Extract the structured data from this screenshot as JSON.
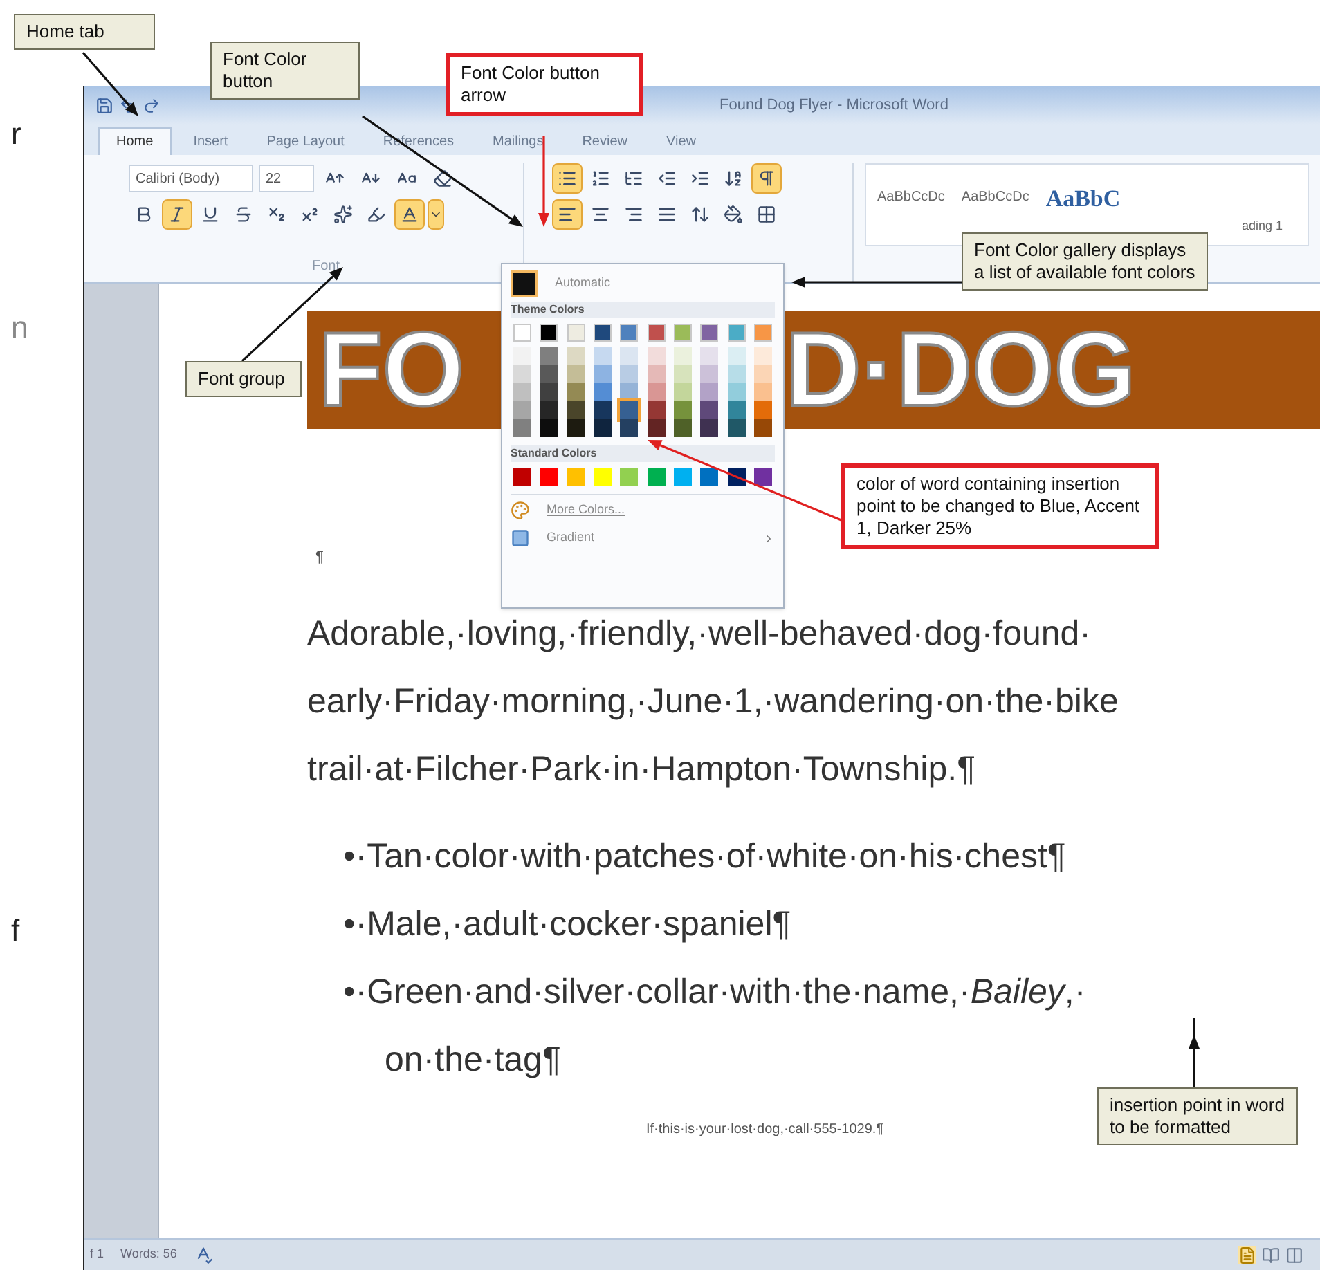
{
  "margin_text": [
    "r",
    "n",
    "f"
  ],
  "window": {
    "title": "Found Dog Flyer - Microsoft Word"
  },
  "tabs": [
    {
      "label": "Home",
      "selected": true
    },
    {
      "label": "Insert",
      "selected": false
    },
    {
      "label": "Page Layout",
      "selected": false
    },
    {
      "label": "References",
      "selected": false
    },
    {
      "label": "Mailings",
      "selected": false
    },
    {
      "label": "Review",
      "selected": false
    },
    {
      "label": "View",
      "selected": false
    }
  ],
  "ribbon": {
    "font": {
      "name": "Calibri (Body)",
      "size": "22",
      "label": "Font",
      "row1": [
        {
          "kind": "grow",
          "selected": false
        },
        {
          "kind": "shrink",
          "selected": false
        },
        {
          "kind": "change_case",
          "selected": false
        },
        {
          "kind": "clear",
          "selected": false
        }
      ],
      "row2": [
        {
          "kind": "bold",
          "selected": false
        },
        {
          "kind": "italic",
          "selected": true
        },
        {
          "kind": "underline",
          "selected": false
        },
        {
          "kind": "strikethrough",
          "selected": false
        },
        {
          "kind": "subscript",
          "selected": false
        },
        {
          "kind": "superscript",
          "selected": false
        },
        {
          "kind": "text_effects",
          "selected": false
        },
        {
          "kind": "highlight",
          "selected": false
        },
        {
          "kind": "font_color",
          "selected": true
        },
        {
          "kind": "font_color_arrow",
          "selected": true
        }
      ]
    },
    "paragraph": {
      "row1": [
        {
          "kind": "bullets",
          "selected": true
        },
        {
          "kind": "numbering",
          "selected": false
        },
        {
          "kind": "multilevel",
          "selected": false
        },
        {
          "kind": "decrease_indent",
          "selected": false
        },
        {
          "kind": "increase_indent",
          "selected": false
        },
        {
          "kind": "sort",
          "selected": false
        },
        {
          "kind": "show_marks",
          "selected": true
        }
      ],
      "row2": [
        {
          "kind": "align_left",
          "selected": true
        },
        {
          "kind": "center",
          "selected": false
        },
        {
          "kind": "align_right",
          "selected": false
        },
        {
          "kind": "justify",
          "selected": false
        },
        {
          "kind": "line_spacing",
          "selected": false
        },
        {
          "kind": "shading",
          "selected": false
        },
        {
          "kind": "borders",
          "selected": false
        }
      ]
    },
    "styles": [
      {
        "sample": "AaBbCcDc",
        "kind": "plain"
      },
      {
        "sample": "AaBbCcDc",
        "kind": "plain"
      },
      {
        "sample": "AaBbC",
        "kind": "heading"
      }
    ],
    "styles_caption": "ading 1"
  },
  "font_color_gallery": {
    "automatic": "Automatic",
    "theme_header": "Theme Colors",
    "standard_header": "Standard Colors",
    "more_colors": "More Colors...",
    "gradient": "Gradient",
    "theme_colors": [
      {
        "color": "#ffffff",
        "selected": false,
        "shades": [
          {
            "color": "#f2f2f2",
            "selected": false
          },
          {
            "color": "#d9d9d9",
            "selected": false
          },
          {
            "color": "#bfbfbf",
            "selected": false
          },
          {
            "color": "#a6a6a6",
            "selected": false
          },
          {
            "color": "#808080",
            "selected": false
          }
        ]
      },
      {
        "color": "#000000",
        "selected": false,
        "shades": [
          {
            "color": "#7f7f7f",
            "selected": false
          },
          {
            "color": "#595959",
            "selected": false
          },
          {
            "color": "#404040",
            "selected": false
          },
          {
            "color": "#262626",
            "selected": false
          },
          {
            "color": "#0d0d0d",
            "selected": false
          }
        ]
      },
      {
        "color": "#eeece1",
        "selected": false,
        "shades": [
          {
            "color": "#ddd9c3",
            "selected": false
          },
          {
            "color": "#c4bd97",
            "selected": false
          },
          {
            "color": "#948a54",
            "selected": false
          },
          {
            "color": "#4a452a",
            "selected": false
          },
          {
            "color": "#1d1b10",
            "selected": false
          }
        ]
      },
      {
        "color": "#1f497d",
        "selected": false,
        "shades": [
          {
            "color": "#c6d9f0",
            "selected": false
          },
          {
            "color": "#8db3e2",
            "selected": false
          },
          {
            "color": "#548dd4",
            "selected": false
          },
          {
            "color": "#17365d",
            "selected": false
          },
          {
            "color": "#0f243e",
            "selected": false
          }
        ]
      },
      {
        "color": "#4f81bd",
        "selected": false,
        "shades": [
          {
            "color": "#dbe5f1",
            "selected": false
          },
          {
            "color": "#b8cce4",
            "selected": false
          },
          {
            "color": "#95b3d7",
            "selected": false
          },
          {
            "color": "#366092",
            "selected": true
          },
          {
            "color": "#244061",
            "selected": false
          }
        ]
      },
      {
        "color": "#c0504d",
        "selected": false,
        "shades": [
          {
            "color": "#f2dcdb",
            "selected": false
          },
          {
            "color": "#e5b9b7",
            "selected": false
          },
          {
            "color": "#d99694",
            "selected": false
          },
          {
            "color": "#953734",
            "selected": false
          },
          {
            "color": "#632423",
            "selected": false
          }
        ]
      },
      {
        "color": "#9bbb59",
        "selected": false,
        "shades": [
          {
            "color": "#ebf1dd",
            "selected": false
          },
          {
            "color": "#d7e3bc",
            "selected": false
          },
          {
            "color": "#c3d69b",
            "selected": false
          },
          {
            "color": "#76923c",
            "selected": false
          },
          {
            "color": "#4f6128",
            "selected": false
          }
        ]
      },
      {
        "color": "#8064a2",
        "selected": false,
        "shades": [
          {
            "color": "#e5e0ec",
            "selected": false
          },
          {
            "color": "#ccc1d9",
            "selected": false
          },
          {
            "color": "#b2a2c7",
            "selected": false
          },
          {
            "color": "#5f497a",
            "selected": false
          },
          {
            "color": "#3f3151",
            "selected": false
          }
        ]
      },
      {
        "color": "#4bacc6",
        "selected": false,
        "shades": [
          {
            "color": "#dbeef3",
            "selected": false
          },
          {
            "color": "#b7dde8",
            "selected": false
          },
          {
            "color": "#92cddc",
            "selected": false
          },
          {
            "color": "#31859b",
            "selected": false
          },
          {
            "color": "#205867",
            "selected": false
          }
        ]
      },
      {
        "color": "#f79646",
        "selected": false,
        "shades": [
          {
            "color": "#fdeada",
            "selected": false
          },
          {
            "color": "#fbd5b5",
            "selected": false
          },
          {
            "color": "#fac08f",
            "selected": false
          },
          {
            "color": "#e36c09",
            "selected": false
          },
          {
            "color": "#974806",
            "selected": false
          }
        ]
      }
    ],
    "standard_colors": [
      {
        "color": "#c00000",
        "selected": false
      },
      {
        "color": "#ff0000",
        "selected": false
      },
      {
        "color": "#ffc000",
        "selected": false
      },
      {
        "color": "#ffff00",
        "selected": false
      },
      {
        "color": "#92d050",
        "selected": false
      },
      {
        "color": "#00b050",
        "selected": false
      },
      {
        "color": "#00b0f0",
        "selected": false
      },
      {
        "color": "#0070c0",
        "selected": false
      },
      {
        "color": "#002060",
        "selected": false
      },
      {
        "color": "#7030a0",
        "selected": false
      }
    ]
  },
  "document": {
    "banner": [
      "FO",
      "D·DOG"
    ],
    "empty_paragraph": "¶",
    "paragraph": [
      "Adorable,·loving,·friendly,·well-behaved·dog·found·",
      "early·Friday·morning,·June·1,·wandering·on·the·bike",
      "trail·at·Filcher·Park·in·Hampton·Township.¶"
    ],
    "bullets": [
      {
        "lines": [
          "•·Tan·color·with·patches·of·white·on·his·chest¶"
        ]
      },
      {
        "lines": [
          "•·Male,·adult·cocker·spaniel¶"
        ]
      },
      {
        "lines": [
          "•·Green·and·silver·collar·with·the·name,·*Bailey*,·",
          "on·the·tag¶"
        ]
      }
    ],
    "footer": "If·this·is·your·lost·dog,·call·555-1029.¶"
  },
  "status_bar": {
    "page": "f 1",
    "words": "Words: 56"
  },
  "callouts": [
    {
      "kind": "plain",
      "text": "Home tab"
    },
    {
      "kind": "plain",
      "text": "Font Color button"
    },
    {
      "kind": "highlight",
      "text": "Font Color button arrow"
    },
    {
      "kind": "plain",
      "text": "Font Color gallery displays a list of available font colors"
    },
    {
      "kind": "plain",
      "text": "Font group"
    },
    {
      "kind": "highlight",
      "text": "color of word containing insertion point to be changed to Blue, Accent 1, Darker 25%"
    },
    {
      "kind": "plain",
      "text": "insertion point in word to be formatted"
    }
  ]
}
